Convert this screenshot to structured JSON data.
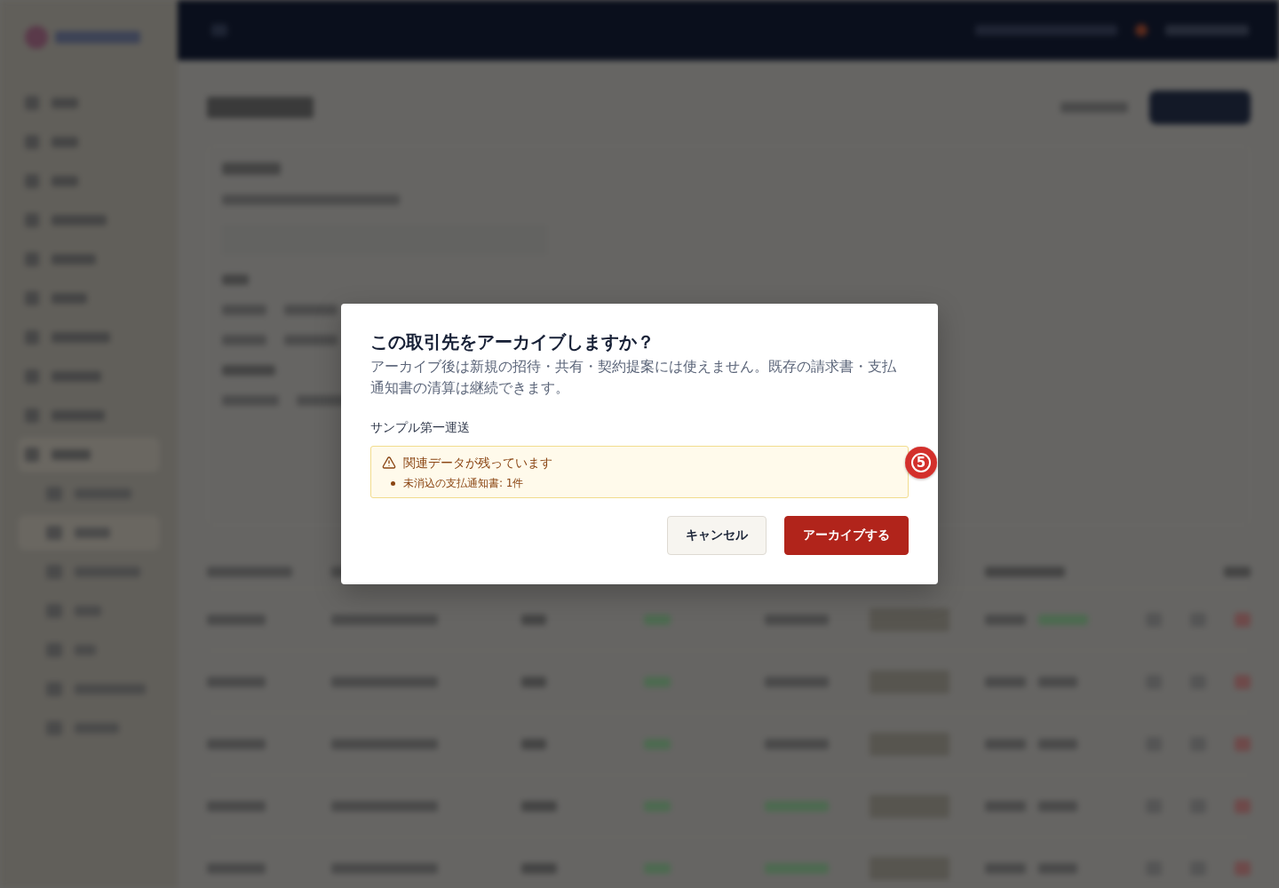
{
  "dialog": {
    "title": "この取引先をアーカイブしますか？",
    "description": "アーカイブ後は新規の招待・共有・契約提案には使えません。既存の請求書・支払通知書の清算は継続できます。",
    "partner_name": "サンプル第一運送",
    "warning": {
      "title": "関連データが残っています",
      "items": [
        "未消込の支払通知書: 1件"
      ]
    },
    "buttons": [
      {
        "label": "キャンセル",
        "kind": "secondary"
      },
      {
        "label": "アーカイブする",
        "kind": "danger"
      }
    ]
  },
  "annotation_marker": {
    "label": "5"
  }
}
